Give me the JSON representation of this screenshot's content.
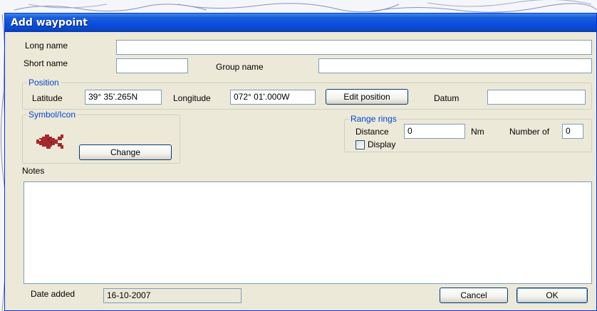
{
  "dialog": {
    "title": "Add waypoint"
  },
  "names": {
    "long_name_label": "Long name",
    "long_name_value": "",
    "short_name_label": "Short name",
    "short_name_value": "",
    "group_name_label": "Group name",
    "group_name_value": ""
  },
  "position": {
    "legend": "Position",
    "latitude_label": "Latitude",
    "latitude_value": "39° 35'.265N",
    "longitude_label": "Longitude",
    "longitude_value": "072° 01'.000W",
    "edit_button": "Edit position",
    "datum_label": "Datum",
    "datum_value": ""
  },
  "symbol": {
    "legend": "Symbol/Icon",
    "icon": "fish-icon",
    "change_button": "Change"
  },
  "range_rings": {
    "legend": "Range rings",
    "distance_label": "Distance",
    "distance_value": "0",
    "unit": "Nm",
    "number_label": "Number of",
    "number_value": "0",
    "display_label": "Display",
    "display_checked": false
  },
  "notes": {
    "label": "Notes",
    "value": ""
  },
  "footer": {
    "date_label": "Date added",
    "date_value": "16-10-2007",
    "cancel_button": "Cancel",
    "ok_button": "OK"
  },
  "colors": {
    "title_bar": "#0a4ee0",
    "dialog_bg": "#ece9d8",
    "legend_text": "#0046d5",
    "fish_icon": "#a52a2a"
  }
}
